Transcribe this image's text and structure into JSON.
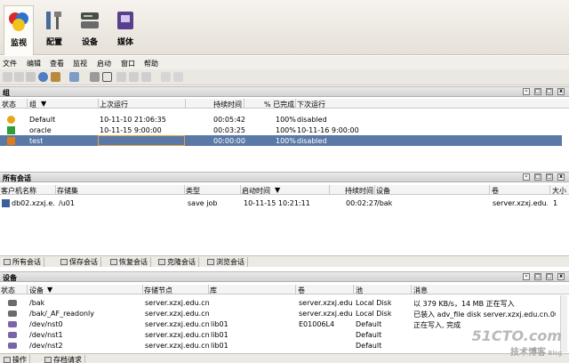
{
  "nav": {
    "items": [
      {
        "label": "监视",
        "icon": "monitor-icon"
      },
      {
        "label": "配置",
        "icon": "config-icon"
      },
      {
        "label": "设备",
        "icon": "devices-icon"
      },
      {
        "label": "媒体",
        "icon": "media-icon"
      }
    ],
    "selected": "监视"
  },
  "menu": [
    "文件",
    "编辑",
    "查看",
    "监视",
    "启动",
    "窗口",
    "帮助"
  ],
  "groups": {
    "title": "组",
    "columns": [
      "状态",
      "组",
      "上次运行",
      "持续时间",
      "% 已完成",
      "下次运行"
    ],
    "rows": [
      {
        "status": "warning",
        "name": "Default",
        "last": "10-11-10 21:06:35",
        "duration": "00:05:42",
        "pct": "100%",
        "next": "disabled"
      },
      {
        "status": "ok",
        "name": "oracle",
        "last": "10-11-15 9:00:00",
        "duration": "00:03:25",
        "pct": "100%",
        "next": "10-11-16 9:00:00"
      },
      {
        "status": "running",
        "name": "test",
        "last": "",
        "duration": "00:00:00",
        "pct": "100%",
        "next": "disabled"
      }
    ]
  },
  "sessions": {
    "title": "所有会话",
    "columns": [
      "客户机名称",
      "存储集",
      "类型",
      "启动时间",
      "持续时间",
      "设备",
      "卷",
      "大小"
    ],
    "rows": [
      {
        "client": "db02.xzxj.e...",
        "saveset": "/u01",
        "type": "save job",
        "start": "10-11-15 10:21:11",
        "duration": "00:02:27",
        "device": "/bak",
        "volume": "server.xzxj.edu....",
        "size": "1"
      }
    ]
  },
  "tabs": [
    "所有会话",
    "保存会话",
    "恢复会话",
    "克隆会话",
    "浏览会话"
  ],
  "devices": {
    "title": "设备",
    "columns": [
      "状态",
      "设备",
      "存储节点",
      "库",
      "卷",
      "池",
      "消息"
    ],
    "rows": [
      {
        "device": "/bak",
        "node": "server.xzxj.edu.cn",
        "lib": "",
        "volume": "server.xzxj.edu....",
        "pool": "Local Disk",
        "msg": "以 379 KB/s，14 MB 正在写入"
      },
      {
        "device": "/bak/_AF_readonly",
        "node": "server.xzxj.edu.cn",
        "lib": "",
        "volume": "server.xzxj.edu....",
        "pool": "Local Disk",
        "msg": "已装入 adv_file disk server.xzxj.edu.cn.001..."
      },
      {
        "device": "/dev/nst0",
        "node": "server.xzxj.edu.cn",
        "lib": "lib01",
        "volume": "E01006L4",
        "pool": "Default",
        "msg": "正在写入, 完成"
      },
      {
        "device": "/dev/nst1",
        "node": "server.xzxj.edu.cn",
        "lib": "lib01",
        "volume": "",
        "pool": "Default",
        "msg": ""
      },
      {
        "device": "/dev/nst2",
        "node": "server.xzxj.edu.cn",
        "lib": "lib01",
        "volume": "",
        "pool": "Default",
        "msg": ""
      }
    ]
  },
  "bottom_tabs": [
    "操作",
    "存档请求"
  ],
  "watermark": {
    "line1": "51CTO.com",
    "line2": "技术博客",
    "line3": "Blog"
  },
  "colors": {
    "selected_row": "#5b79a6",
    "warning": "#e8a517",
    "ok": "#2e9e3a"
  }
}
